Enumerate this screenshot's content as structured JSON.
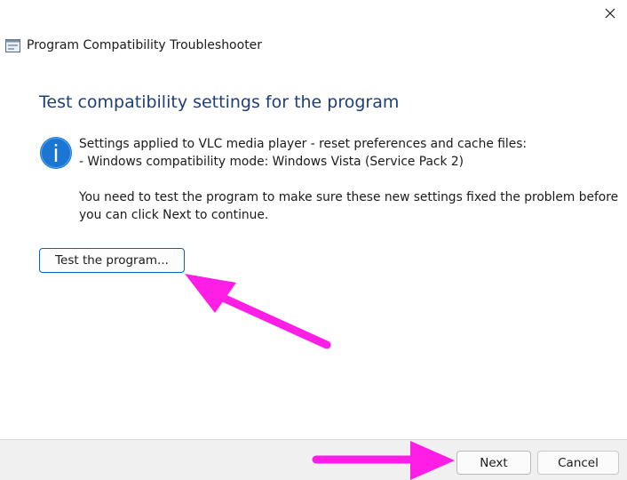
{
  "window": {
    "title": "Program Compatibility Troubleshooter",
    "close_icon": "close-icon",
    "app_icon": "troubleshooter-icon"
  },
  "content": {
    "heading": "Test compatibility settings for the program",
    "info_icon": "info-icon",
    "settings_line": "Settings applied to VLC media player - reset preferences and cache files:",
    "mode_line": "- Windows compatibility mode: Windows Vista (Service Pack 2)",
    "instruction_line1": "You need to test the program to make sure these new settings fixed the problem before",
    "instruction_line2": "you can click Next to continue.",
    "test_button_label": "Test the program..."
  },
  "footer": {
    "next_label": "Next",
    "cancel_label": "Cancel"
  },
  "annotations": {
    "arrow_color": "#ff1ee6"
  },
  "colors": {
    "heading": "#1e3f77",
    "accent": "#0067c0",
    "info_icon": "#1a76d2",
    "footer_bg": "#f0f0f0"
  }
}
